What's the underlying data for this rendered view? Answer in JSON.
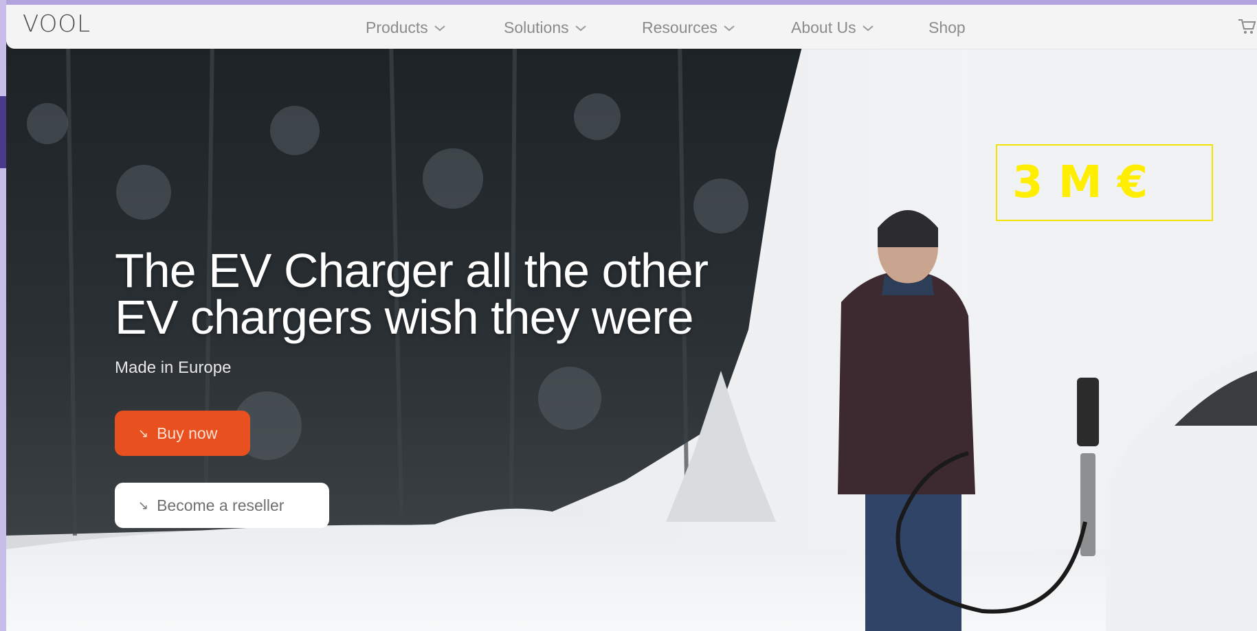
{
  "brand": "VOOL",
  "nav": {
    "items": [
      {
        "label": "Products",
        "has_dropdown": true
      },
      {
        "label": "Solutions",
        "has_dropdown": true
      },
      {
        "label": "Resources",
        "has_dropdown": true
      },
      {
        "label": "About Us",
        "has_dropdown": true
      },
      {
        "label": "Shop",
        "has_dropdown": false
      }
    ],
    "cart_icon": "cart-icon"
  },
  "hero": {
    "headline_line1": "The EV Charger all the other",
    "headline_line2": "EV chargers wish they were",
    "subtitle": "Made in Europe",
    "buy_label": "Buy now",
    "reseller_label": "Become a reseller",
    "button_icon": "arrow-down-right-icon"
  },
  "overlay_badge": "3 M €",
  "colors": {
    "accent": "#e8511f",
    "badge": "#ffee00",
    "frame": "#b2a3de"
  }
}
